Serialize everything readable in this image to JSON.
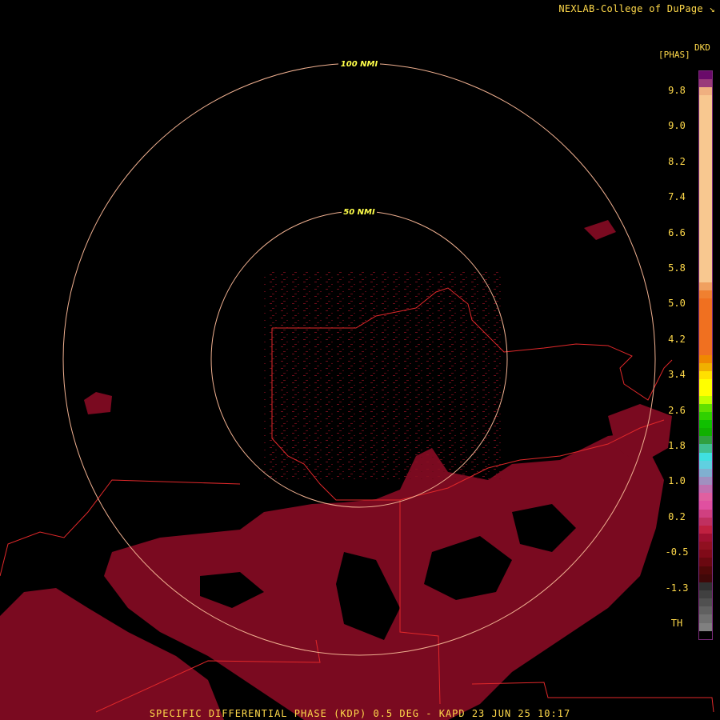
{
  "credit": "NEXLAB-College of DuPage ↘",
  "caption": "SPECIFIC DIFFERENTIAL PHASE (KDP) 0.5 DEG - KAPD 23 JUN 25 10:17",
  "legend": {
    "product_code": "DKD",
    "unit": "[PHAS]",
    "ticks": [
      "9.8",
      "9.0",
      "8.2",
      "7.4",
      "6.6",
      "5.8",
      "5.0",
      "4.2",
      "3.4",
      "2.6",
      "1.8",
      "1.0",
      "0.2",
      "-0.5",
      "-1.3",
      "TH"
    ],
    "colors": [
      "#6a0a6a",
      "#9a3a7a",
      "#f0b080",
      "#f8c890",
      "#f8c890",
      "#f8c890",
      "#f8c890",
      "#f8c890",
      "#f8c890",
      "#f8c890",
      "#f8c890",
      "#f8c890",
      "#f8c890",
      "#f8c890",
      "#f8c890",
      "#f8c890",
      "#f8c890",
      "#f8c890",
      "#f8c890",
      "#f8c890",
      "#f8c890",
      "#f8c890",
      "#f8c890",
      "#f8c890",
      "#f8c890",
      "#f8c890",
      "#f0a060",
      "#f08030",
      "#f07020",
      "#f07020",
      "#f07020",
      "#f07020",
      "#f07020",
      "#f07020",
      "#f07020",
      "#f08800",
      "#f0b000",
      "#ffe000",
      "#ffff00",
      "#ffff00",
      "#c0ff00",
      "#60e000",
      "#30d000",
      "#10c000",
      "#10b000",
      "#30a040",
      "#40c090",
      "#40e0e0",
      "#60d0e0",
      "#80b0d0",
      "#a090c0",
      "#c070b0",
      "#e060a0",
      "#e050a0",
      "#d04080",
      "#c03060",
      "#c02040",
      "#a01030",
      "#901020",
      "#800a18",
      "#6a0810",
      "#500808",
      "#400808",
      "#303030",
      "#404040",
      "#505050",
      "#606060",
      "#707070",
      "#808080",
      "#000000"
    ]
  },
  "rings": [
    {
      "label": "100 NMI"
    },
    {
      "label": "50 NMI"
    }
  ]
}
